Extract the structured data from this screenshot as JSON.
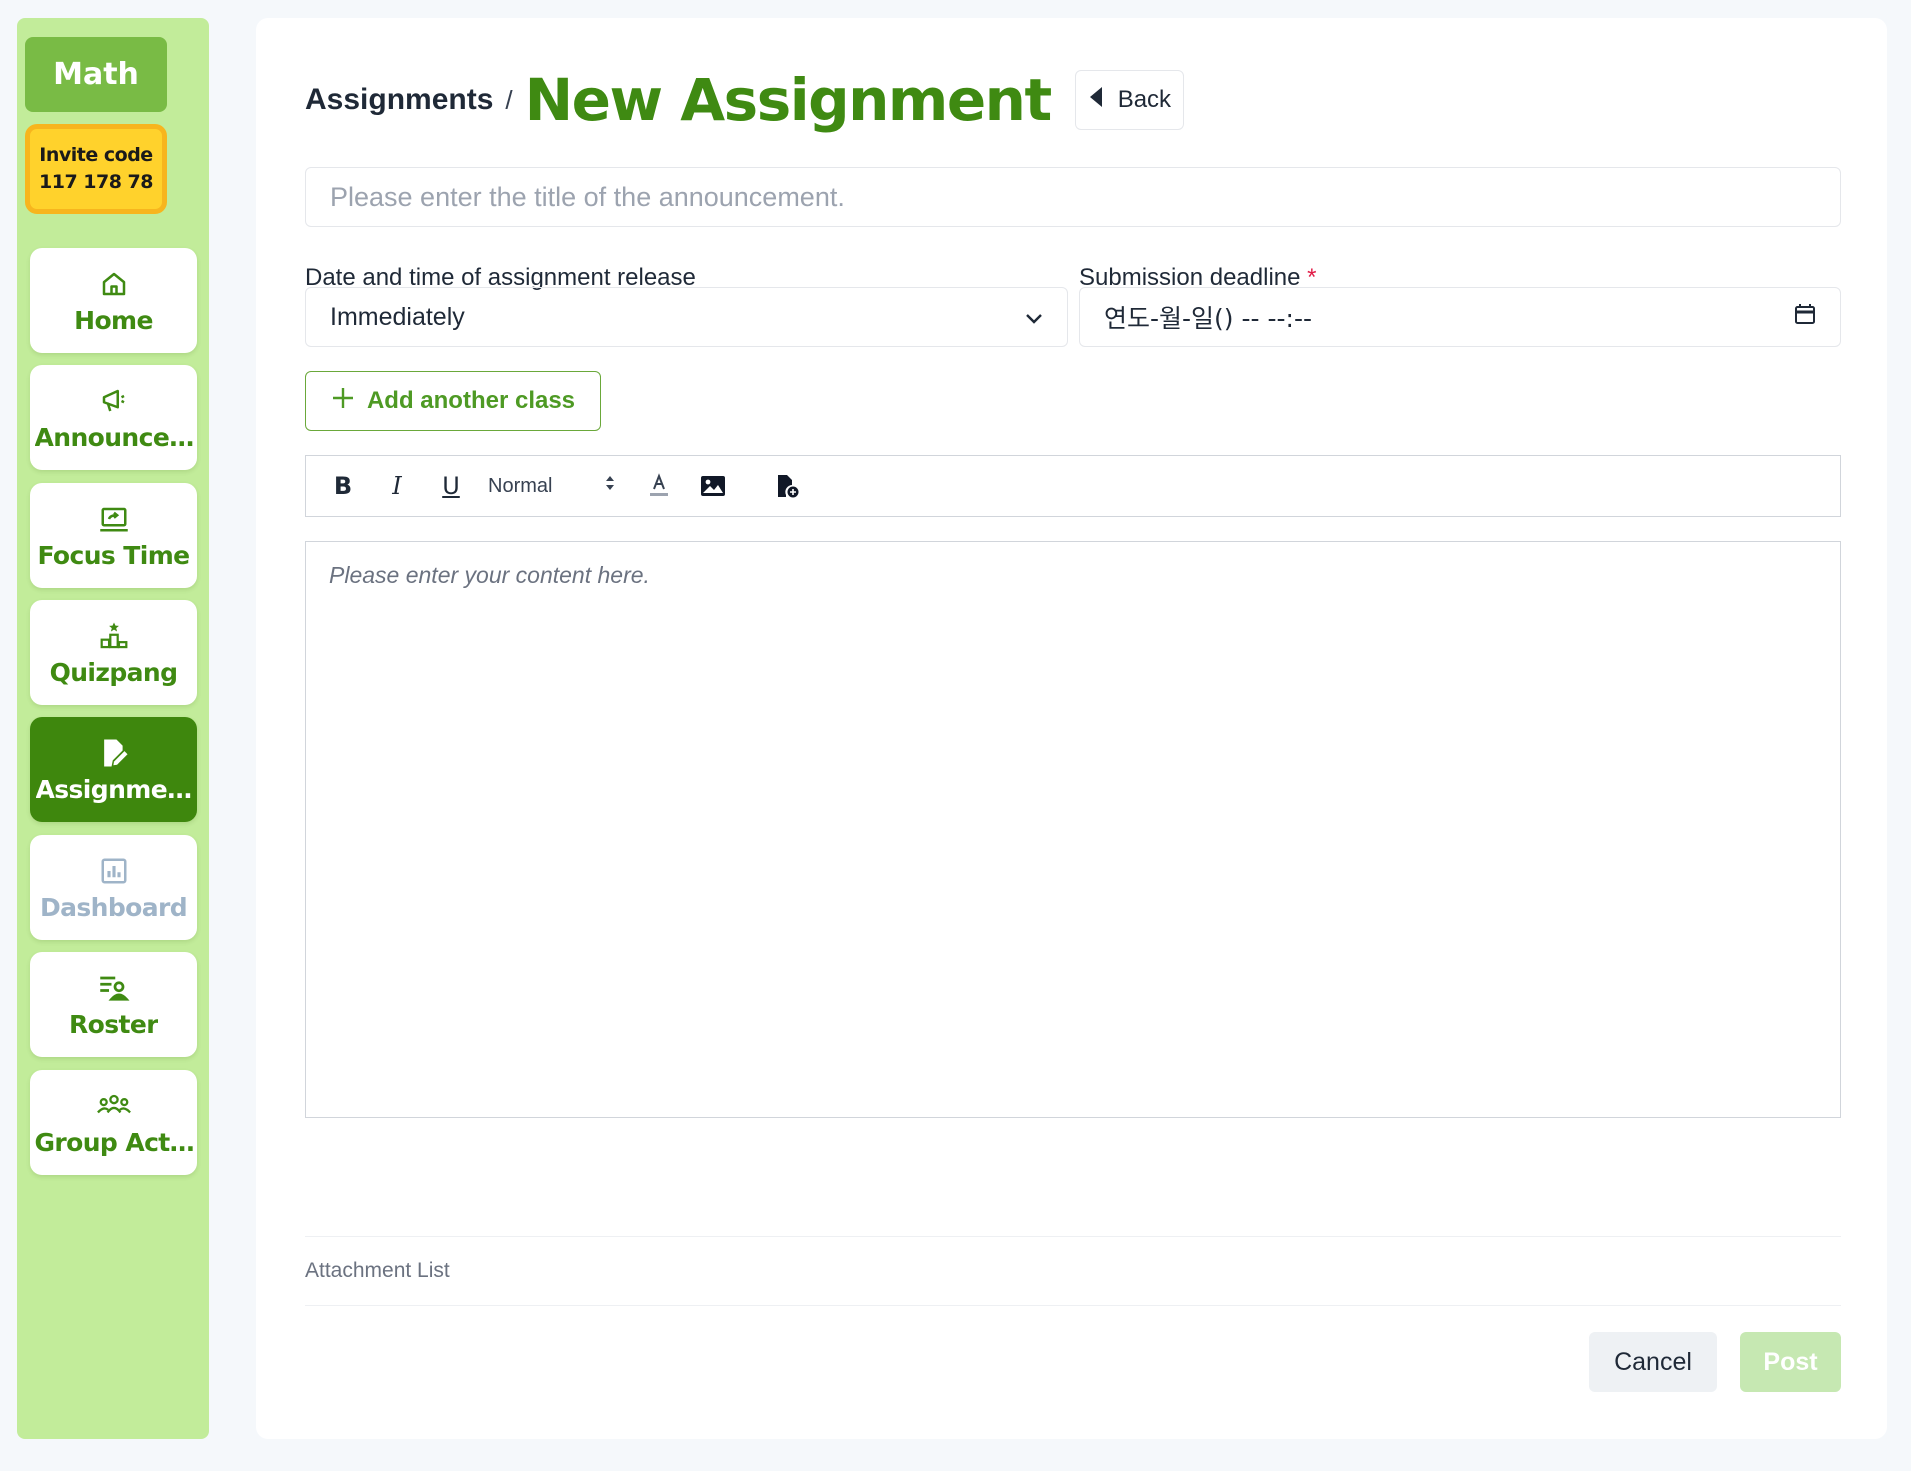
{
  "sidebar": {
    "class_name": "Math",
    "invite_label": "Invite code",
    "invite_code": "117 178 78",
    "items": [
      {
        "label": "Home",
        "icon": "home-icon"
      },
      {
        "label": "Announce…",
        "icon": "megaphone-icon"
      },
      {
        "label": "Focus Time",
        "icon": "monitor-icon"
      },
      {
        "label": "Quizpang",
        "icon": "podium-icon"
      },
      {
        "label": "Assignme…",
        "icon": "edit-file-icon",
        "active": true
      },
      {
        "label": "Dashboard",
        "icon": "bar-chart-icon",
        "disabled": true
      },
      {
        "label": "Roster",
        "icon": "roster-icon"
      },
      {
        "label": "Group Act…",
        "icon": "group-icon"
      }
    ]
  },
  "header": {
    "breadcrumb": "Assignments",
    "separator": "/",
    "title": "New Assignment",
    "back_label": "Back"
  },
  "form": {
    "title_placeholder": "Please enter the title of the announcement.",
    "release_label": "Date and time of assignment release",
    "release_value": "Immediately",
    "deadline_label": "Submission deadline",
    "deadline_required": "*",
    "deadline_value": "연도-월-일() -- --:--",
    "add_class_label": "Add another class",
    "toolbar": {
      "bold": "B",
      "italic": "I",
      "underline": "U",
      "format_value": "Normal"
    },
    "content_placeholder": "Please enter your content here.",
    "attachment_label": "Attachment List",
    "cancel_label": "Cancel",
    "post_label": "Post"
  },
  "colors": {
    "brand_green": "#3f8a12",
    "sidebar_bg": "#c2ec9a",
    "invite_yellow": "#ffd22c",
    "post_disabled": "#c6e8b2"
  }
}
